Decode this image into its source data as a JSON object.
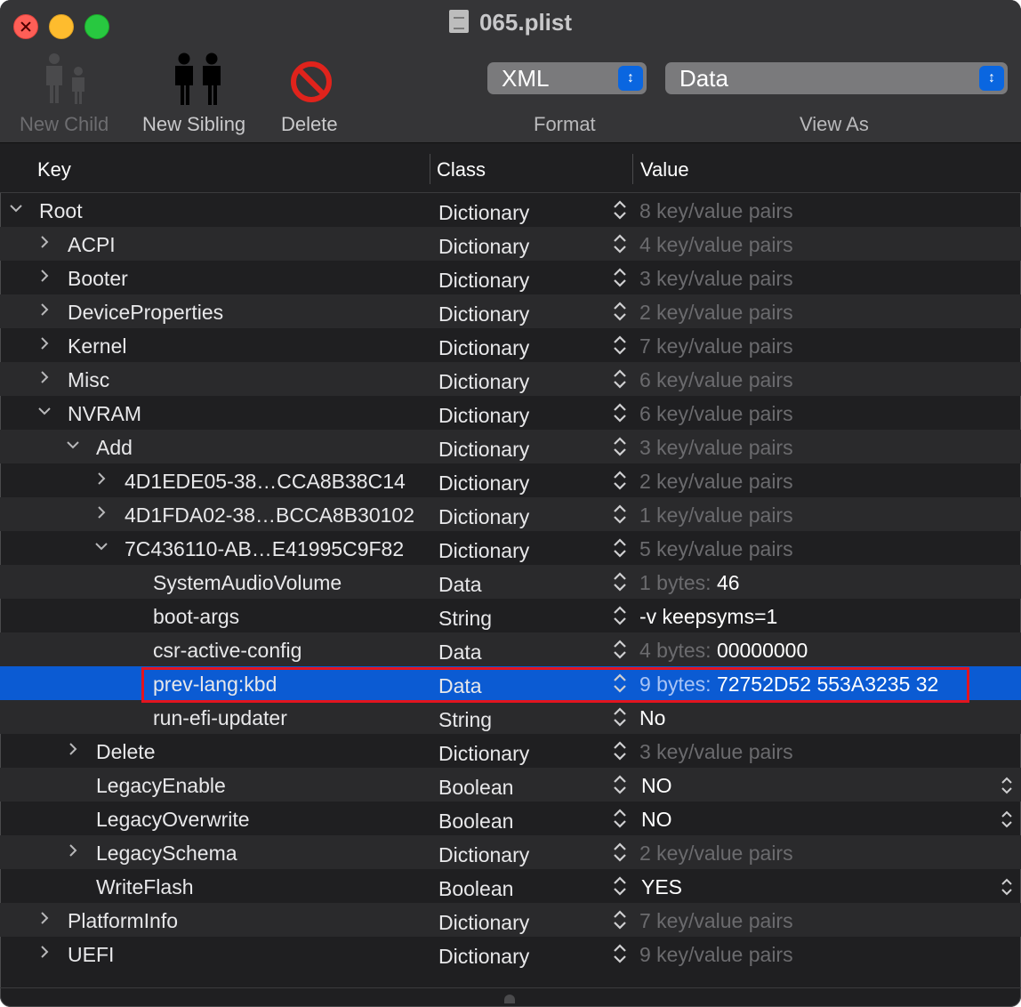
{
  "window": {
    "title": "065.plist"
  },
  "toolbar": {
    "new_child": "New Child",
    "new_sibling": "New Sibling",
    "delete": "Delete",
    "format_label": "Format",
    "format_value": "XML",
    "viewas_label": "View As",
    "viewas_value": "Data"
  },
  "table": {
    "headers": {
      "key": "Key",
      "class": "Class",
      "value": "Value"
    },
    "rows": [
      {
        "key": "Root",
        "class": "Dictionary",
        "value_dim": "8 key/value pairs",
        "value": "",
        "disclosure": "open"
      },
      {
        "key": "ACPI",
        "class": "Dictionary",
        "value_dim": "4 key/value pairs",
        "value": "",
        "disclosure": "closed"
      },
      {
        "key": "Booter",
        "class": "Dictionary",
        "value_dim": "3 key/value pairs",
        "value": "",
        "disclosure": "closed"
      },
      {
        "key": "DeviceProperties",
        "class": "Dictionary",
        "value_dim": "2 key/value pairs",
        "value": "",
        "disclosure": "closed"
      },
      {
        "key": "Kernel",
        "class": "Dictionary",
        "value_dim": "7 key/value pairs",
        "value": "",
        "disclosure": "closed"
      },
      {
        "key": "Misc",
        "class": "Dictionary",
        "value_dim": "6 key/value pairs",
        "value": "",
        "disclosure": "closed"
      },
      {
        "key": "NVRAM",
        "class": "Dictionary",
        "value_dim": "6 key/value pairs",
        "value": "",
        "disclosure": "open"
      },
      {
        "key": "Add",
        "class": "Dictionary",
        "value_dim": "3 key/value pairs",
        "value": "",
        "disclosure": "open"
      },
      {
        "key": "4D1EDE05-38…CCA8B38C14",
        "class": "Dictionary",
        "value_dim": "2 key/value pairs",
        "value": "",
        "disclosure": "closed"
      },
      {
        "key": "4D1FDA02-38…BCCA8B30102",
        "class": "Dictionary",
        "value_dim": "1 key/value pairs",
        "value": "",
        "disclosure": "closed"
      },
      {
        "key": "7C436110-AB…E41995C9F82",
        "class": "Dictionary",
        "value_dim": "5 key/value pairs",
        "value": "",
        "disclosure": "open"
      },
      {
        "key": "SystemAudioVolume",
        "class": "Data",
        "value_dim": "1 bytes:",
        "value": "46",
        "disclosure": ""
      },
      {
        "key": "boot-args",
        "class": "String",
        "value_dim": "",
        "value": "-v keepsyms=1",
        "disclosure": ""
      },
      {
        "key": "csr-active-config",
        "class": "Data",
        "value_dim": "4 bytes:",
        "value": "00000000",
        "disclosure": ""
      },
      {
        "key": "prev-lang:kbd",
        "class": "Data",
        "value_dim": "9 bytes:",
        "value": "72752D52 553A3235 32",
        "disclosure": "",
        "selected": true
      },
      {
        "key": "run-efi-updater",
        "class": "String",
        "value_dim": "",
        "value": "No",
        "disclosure": ""
      },
      {
        "key": "Delete",
        "class": "Dictionary",
        "value_dim": "3 key/value pairs",
        "value": "",
        "disclosure": "closed"
      },
      {
        "key": "LegacyEnable",
        "class": "Boolean",
        "value_dim": "",
        "value": "NO",
        "disclosure": "",
        "popup": true
      },
      {
        "key": "LegacyOverwrite",
        "class": "Boolean",
        "value_dim": "",
        "value": "NO",
        "disclosure": "",
        "popup": true
      },
      {
        "key": "LegacySchema",
        "class": "Dictionary",
        "value_dim": "2 key/value pairs",
        "value": "",
        "disclosure": "closed"
      },
      {
        "key": "WriteFlash",
        "class": "Boolean",
        "value_dim": "",
        "value": "YES",
        "disclosure": "",
        "popup": true
      },
      {
        "key": "PlatformInfo",
        "class": "Dictionary",
        "value_dim": "7 key/value pairs",
        "value": "",
        "disclosure": "closed"
      },
      {
        "key": "UEFI",
        "class": "Dictionary",
        "value_dim": "9 key/value pairs",
        "value": "",
        "disclosure": "closed"
      }
    ]
  },
  "colors": {
    "selection": "#0b5bd3",
    "highlight_box": "#e3141e",
    "accent": "#0a66e0"
  }
}
